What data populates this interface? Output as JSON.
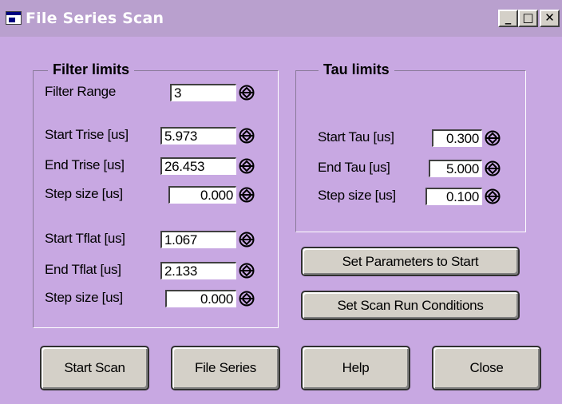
{
  "window": {
    "title": "File Series Scan",
    "minimize": "_",
    "maximize": "□",
    "close": "✕"
  },
  "filter": {
    "legend": "Filter limits",
    "range_label": "Filter Range",
    "range_value": "3",
    "start_trise_label": "Start Trise [us]",
    "start_trise_value": "5.973",
    "end_trise_label": "End Trise [us]",
    "end_trise_value": "26.453",
    "trise_step_label": "Step size [us]",
    "trise_step_value": "0.000",
    "start_tflat_label": "Start Tflat [us]",
    "start_tflat_value": "1.067",
    "end_tflat_label": "End Tflat [us]",
    "end_tflat_value": "2.133",
    "tflat_step_label": "Step size [us]",
    "tflat_step_value": "0.000"
  },
  "tau": {
    "legend": "Tau limits",
    "start_label": "Start Tau [us]",
    "start_value": "0.300",
    "end_label": "End Tau [us]",
    "end_value": "5.000",
    "step_label": "Step size [us]",
    "step_value": "0.100"
  },
  "buttons": {
    "set_params": "Set Parameters to Start",
    "set_scan": "Set Scan Run Conditions",
    "start_scan": "Start Scan",
    "file_series": "File Series",
    "help": "Help",
    "close": "Close"
  },
  "colors": {
    "window_bg": "#c8a8e2",
    "titlebar": "#b9a0ce",
    "button_face": "#d4d0c8"
  },
  "icons": {
    "spin": "up-down-arrow-icon",
    "app": "app-window-icon"
  }
}
